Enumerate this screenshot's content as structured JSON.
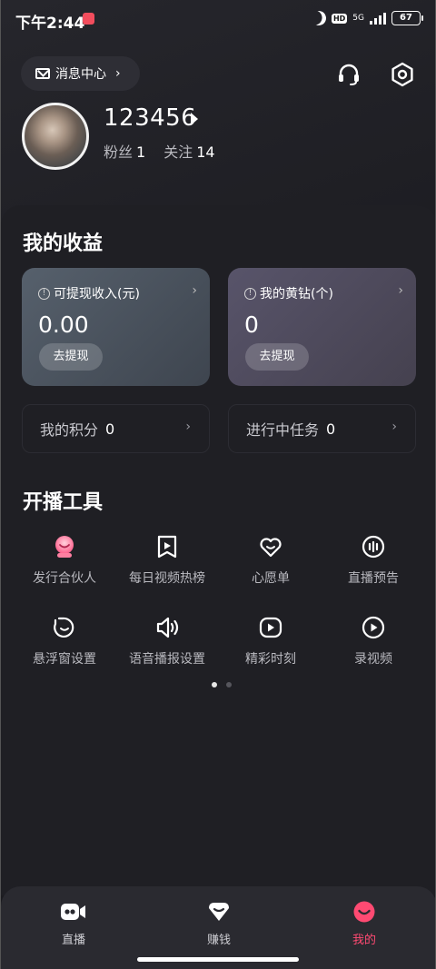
{
  "status_bar": {
    "time": "下午2:44",
    "hd_badge": "HD",
    "network": "5G",
    "battery": "67"
  },
  "header": {
    "message_center_label": "消息中心",
    "message_center_chevron": "›",
    "support_icon": "headset-icon",
    "settings_icon": "hexagon-gear-icon"
  },
  "profile": {
    "username": "123456",
    "fans_label": "粉丝",
    "fans_count": "1",
    "following_label": "关注",
    "following_count": "14"
  },
  "earnings": {
    "title": "我的收益",
    "cards": [
      {
        "label": "可提现收入(元)",
        "value": "0.00",
        "button": "去提现"
      },
      {
        "label": "我的黄钻(个)",
        "value": "0",
        "button": "去提现"
      }
    ],
    "info_glyph": "!",
    "arrow_glyph": "›",
    "rows": [
      {
        "label": "我的积分",
        "value": "0"
      },
      {
        "label": "进行中任务",
        "value": "0"
      }
    ]
  },
  "tools": {
    "title": "开播工具",
    "items": [
      {
        "label": "发行合伙人",
        "icon": "partner-badge-icon"
      },
      {
        "label": "每日视频热榜",
        "icon": "bookmark-play-icon"
      },
      {
        "label": "心愿单",
        "icon": "heart-icon"
      },
      {
        "label": "直播预告",
        "icon": "live-preview-icon"
      },
      {
        "label": "悬浮窗设置",
        "icon": "floating-window-icon"
      },
      {
        "label": "语音播报设置",
        "icon": "speaker-icon"
      },
      {
        "label": "精彩时刻",
        "icon": "highlight-play-icon"
      },
      {
        "label": "录视频",
        "icon": "record-video-icon"
      }
    ],
    "page_count": 2,
    "active_page": 1
  },
  "tabbar": {
    "tabs": [
      {
        "label": "直播",
        "icon": "video-camera-icon"
      },
      {
        "label": "赚钱",
        "icon": "diamond-smile-icon"
      },
      {
        "label": "我的",
        "icon": "smile-face-icon",
        "active": true
      }
    ],
    "active_color": "#ff4a72"
  }
}
